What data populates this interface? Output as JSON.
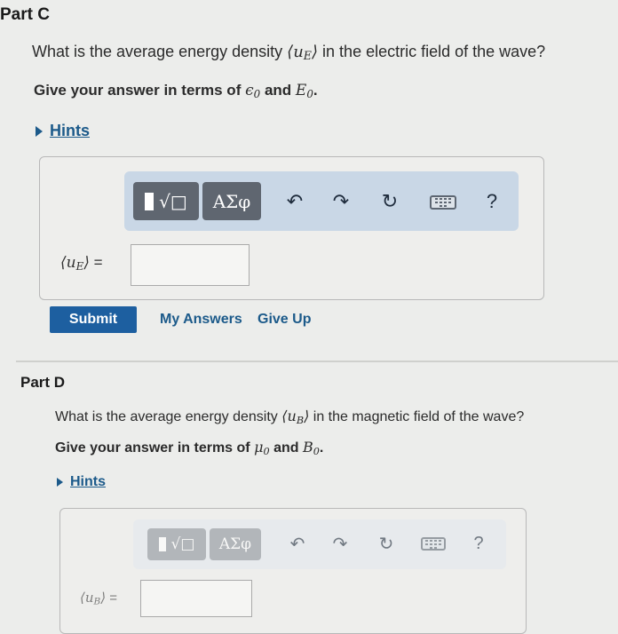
{
  "partC": {
    "title": "Part C",
    "question_pre": "What is the average energy density",
    "symbol": "u",
    "symbol_sub": "E",
    "question_post": "in the electric field of the wave?",
    "instruction_pre": "Give your answer in terms of",
    "term1": "ϵ",
    "term1_sub": "0",
    "and": "and",
    "term2": "E",
    "term2_sub": "0",
    "period": ".",
    "hints": "Hints",
    "input_label_sym": "u",
    "input_label_sub": "E",
    "input_label_eq": "=",
    "submit": "Submit",
    "my_answers": "My Answers",
    "give_up": "Give Up"
  },
  "partD": {
    "title": "Part D",
    "question_pre": "What is the average energy density",
    "symbol": "u",
    "symbol_sub": "B",
    "question_post": "in the magnetic field of the wave?",
    "instruction_pre": "Give your answer in terms of",
    "term1": "μ",
    "term1_sub": "0",
    "and": "and",
    "term2": "B",
    "term2_sub": "0",
    "period": ".",
    "hints": "Hints",
    "input_label_sym": "u",
    "input_label_sub": "B",
    "input_label_eq": "="
  },
  "toolbar": {
    "templates": "√□",
    "greek": "ΑΣφ",
    "undo": "↶",
    "redo": "↷",
    "reset": "↻",
    "help": "?",
    "icons": [
      "templates-icon",
      "greek-letters-icon",
      "undo-icon",
      "redo-icon",
      "reset-icon",
      "keyboard-icon",
      "help-icon"
    ]
  },
  "colors": {
    "accent": "#1d5fa0",
    "toolbar_bg": "#c9d7e6",
    "button_bg": "#5f6670"
  }
}
